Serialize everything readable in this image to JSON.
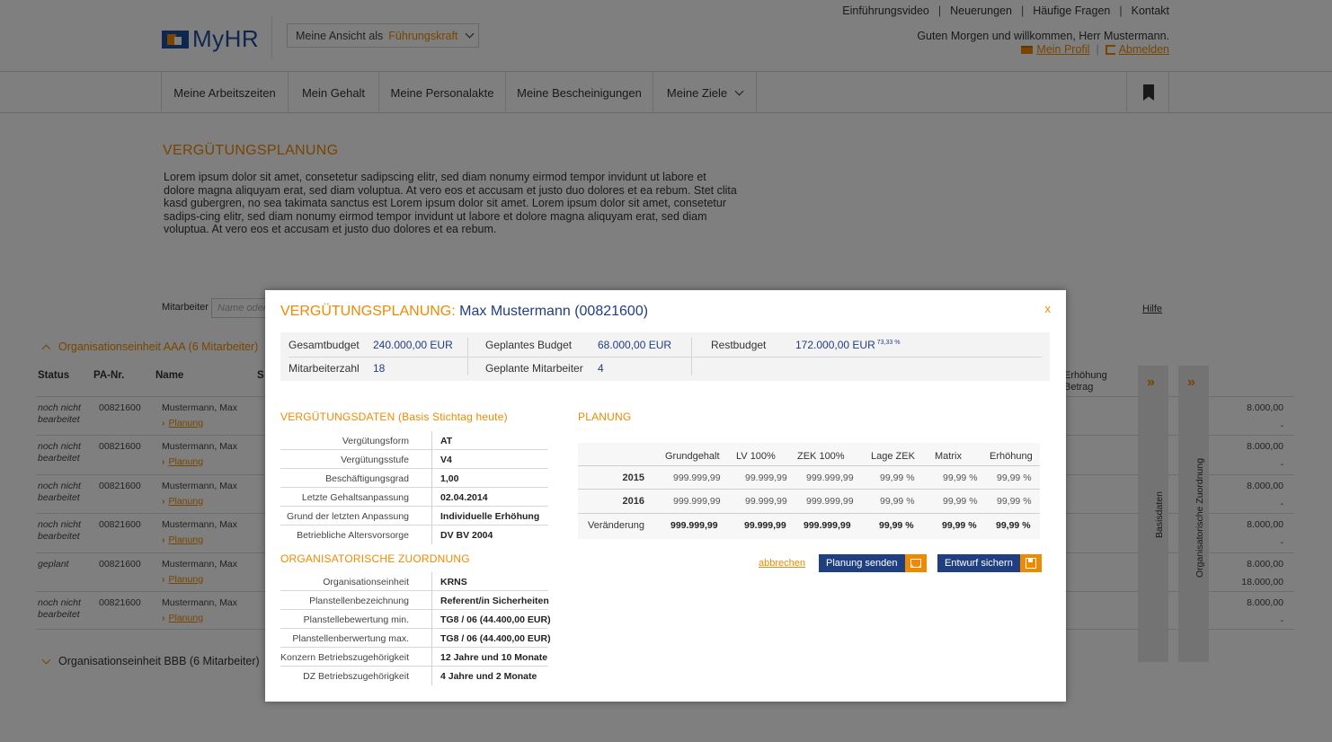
{
  "header": {
    "logo_text": "MyHR",
    "view_label": "Meine Ansicht als",
    "view_value": "Führungskraft",
    "top_links": [
      "Einführungsvideo",
      "Neuerungen",
      "Häufige Fragen",
      "Kontakt"
    ],
    "greeting": "Guten Morgen und willkommen, Herr Mustermann.",
    "profile_link": "Mein Profil",
    "logout_link": "Abmelden"
  },
  "nav": {
    "items": [
      "Meine Arbeitszeiten",
      "Mein Gehalt",
      "Meine Personalakte",
      "Meine Bescheinigungen",
      "Meine Ziele"
    ]
  },
  "page": {
    "title": "VERGÜTUNGSPLANUNG",
    "intro": "Lorem ipsum dolor sit amet, consetetur sadipscing elitr, sed diam nonumy eirmod tempor invidunt ut labore et dolore magna aliquyam erat, sed diam voluptua. At vero eos et accusam et justo duo dolores et ea rebum. Stet clita kasd gubergren, no sea takimata sanctus est Lorem ipsum dolor sit amet. Lorem ipsum dolor sit amet, consetetur sadips-cing elitr, sed diam nonumy eirmod tempor invidunt ut labore et dolore magna aliquyam erat, sed diam voluptua. At vero eos et accusam et justo duo dolores et ea rebum.",
    "filter_label": "Mitarbeiter",
    "filter_placeholder": "Name oder",
    "help_link": "Hilfe",
    "group_a": "Organisationseinheit AAA (6 Mitarbeiter)",
    "group_b": "Organisationseinheit BBB (6 Mitarbeiter)",
    "columns": {
      "status": "Status",
      "pa": "PA-Nr.",
      "name": "Name",
      "s": "S",
      "erh": "Erhöhung",
      "betrag": "Betrag"
    },
    "rows": [
      {
        "status": "noch nicht bearbeitet",
        "pa": "00821600",
        "name": "Mustermann, Max",
        "link": "Planung",
        "v1": "8.000,00",
        "v2": "-"
      },
      {
        "status": "noch nicht bearbeitet",
        "pa": "00821600",
        "name": "Mustermann, Max",
        "link": "Planung",
        "v1": "8.000,00",
        "v2": "-"
      },
      {
        "status": "noch nicht bearbeitet",
        "pa": "00821600",
        "name": "Mustermann, Max",
        "link": "Planung",
        "v1": "8.000,00",
        "v2": "-"
      },
      {
        "status": "noch nicht bearbeitet",
        "pa": "00821600",
        "name": "Mustermann, Max",
        "link": "Planung",
        "v1": "8.000,00",
        "v2": "-"
      },
      {
        "status": "geplant",
        "pa": "00821600",
        "name": "Mustermann, Max",
        "link": "Planung",
        "v1": "8.000,00",
        "v2": "18.000,00"
      },
      {
        "status": "noch nicht bearbeitet",
        "pa": "00821600",
        "name": "Mustermann, Max",
        "link": "Planung",
        "v1": "8.000,00",
        "v2": "-"
      }
    ],
    "side_basis": "Basisdaten",
    "side_org": "Organisatorische Zuordnung"
  },
  "modal": {
    "title_prefix": "VERGÜTUNGSPLANUNG:",
    "title_name": "Max Mustermann (00821600)",
    "close": "x",
    "summary": {
      "gesamt_label": "Gesamtbudget",
      "gesamt_value": "240.000,00 EUR",
      "geplant_label": "Geplantes Budget",
      "geplant_value": "68.000,00 EUR",
      "rest_label": "Restbudget",
      "rest_value": "172.000,00 EUR",
      "rest_pct": "73,33 %",
      "ma_label": "Mitarbeiterzahl",
      "ma_value": "18",
      "gma_label": "Geplante Mitarbeiter",
      "gma_value": "4"
    },
    "verg_title": "VERGÜTUNGSDATEN (Basis Stichtag heute)",
    "verg": [
      {
        "k": "Vergütungsform",
        "v": "AT"
      },
      {
        "k": "Vergütungsstufe",
        "v": "V4"
      },
      {
        "k": "Beschäftigungsgrad",
        "v": "1,00"
      },
      {
        "k": "Letzte Gehaltsanpassung",
        "v": "02.04.2014"
      },
      {
        "k": "Grund der letzten Anpassung",
        "v": "Individuelle Erhöhung"
      },
      {
        "k": "Betriebliche Altersvorsorge",
        "v": "DV BV 2004"
      }
    ],
    "org_title": "ORGANISATORISCHE ZUORDNUNG",
    "org": [
      {
        "k": "Organisationseinheit",
        "v": "KRNS"
      },
      {
        "k": "Planstellenbezeichnung",
        "v": "Referent/in Sicherheiten"
      },
      {
        "k": "Planstellebewertung min.",
        "v": "TG8 / 06 (44.400,00 EUR)"
      },
      {
        "k": "Planstellenberwertung max.",
        "v": "TG8 / 06 (44.400,00 EUR)"
      },
      {
        "k": "Konzern Betriebszugehörigkeit",
        "v": "12 Jahre und 10 Monate"
      },
      {
        "k": "DZ Betriebszugehörigkeit",
        "v": "4 Jahre und 2 Monate"
      }
    ],
    "plan_title": "PLANUNG",
    "plan_headers": [
      "Grundgehalt",
      "LV 100%",
      "ZEK 100%",
      "Lage ZEK",
      "Matrix",
      "Erhöhung"
    ],
    "plan_rows": [
      {
        "label": "2015",
        "cells": [
          "999.999,99",
          "99.999,99",
          "999.999,99",
          "99,99 %",
          "99,99 %",
          "99,99 %"
        ]
      },
      {
        "label": "2016",
        "cells": [
          "999.999,99",
          "99.999,99",
          "999.999,99",
          "99,99 %",
          "99,99 %",
          "99,99 %"
        ]
      },
      {
        "label": "Veränderung",
        "cells": [
          "999.999,99",
          "99.999,99",
          "999.999,99",
          "99,99 %",
          "99,99 %",
          "99,99 %"
        ]
      }
    ],
    "cancel": "abbrechen",
    "send": "Planung senden",
    "save": "Entwurf sichern"
  }
}
